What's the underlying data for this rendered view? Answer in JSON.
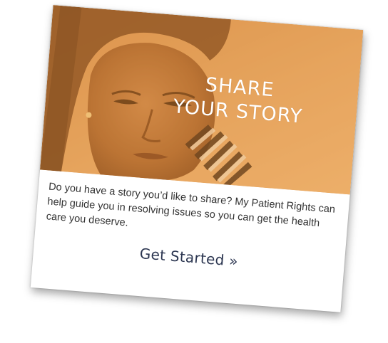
{
  "card": {
    "title_line1": "SHARE",
    "title_line2": "YOUR STORY",
    "description": "Do you have a story you’d like to share? My Patient Rights can help guide you in resolving issues so you can get the health care you deserve.",
    "cta_label": "Get Started »"
  },
  "colors": {
    "hero_overlay": "#e0a15f",
    "title_text": "#ffffff",
    "body_text": "#333333",
    "cta_text": "#2b3550"
  }
}
